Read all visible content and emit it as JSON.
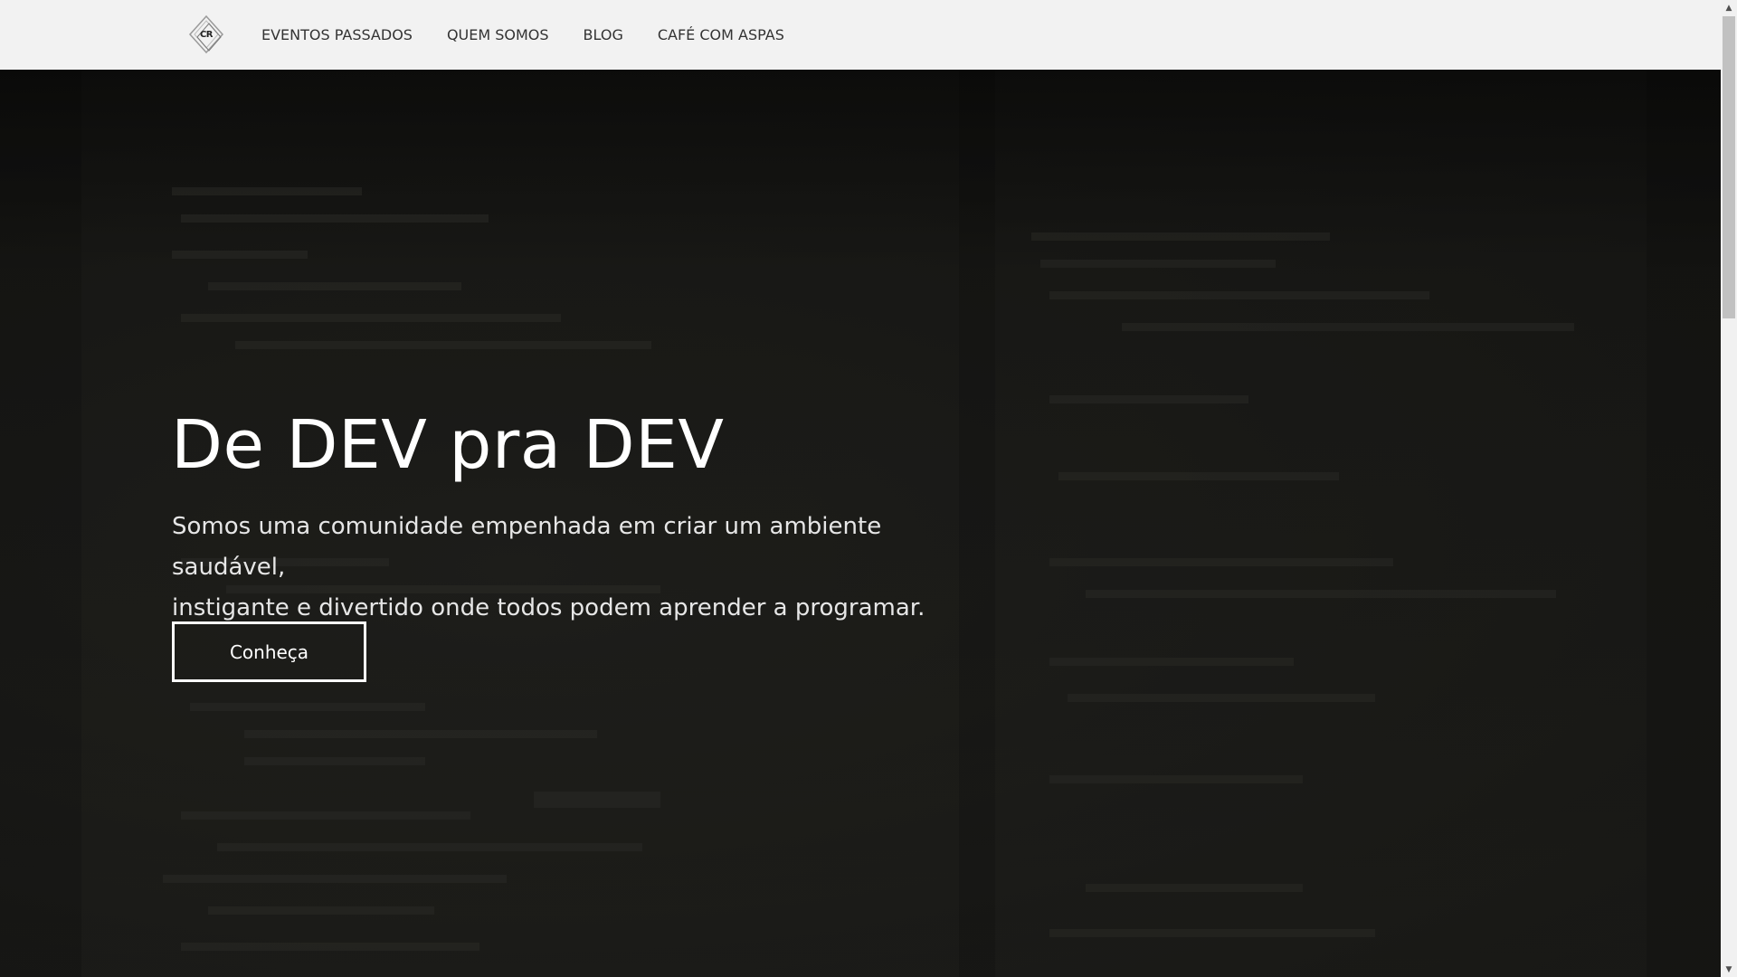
{
  "nav": {
    "logo_text": "CR",
    "items": [
      {
        "label": "EVENTOS PASSADOS"
      },
      {
        "label": "QUEM SOMOS"
      },
      {
        "label": "BLOG"
      },
      {
        "label": "CAFÉ COM ASPAS"
      }
    ]
  },
  "hero": {
    "title": "De DEV pra DEV",
    "subtitle_line1": "Somos uma comunidade empenhada em criar um ambiente saudável,",
    "subtitle_line2": "instigante e divertido onde todos podem aprender a programar.",
    "cta_label": "Conheça"
  },
  "scrollbar": {
    "position_fraction": 0.0
  },
  "colors": {
    "nav_background": "#f2f2f2",
    "nav_text": "#333333",
    "hero_background": "#1a1a18",
    "hero_text": "#ffffff"
  }
}
